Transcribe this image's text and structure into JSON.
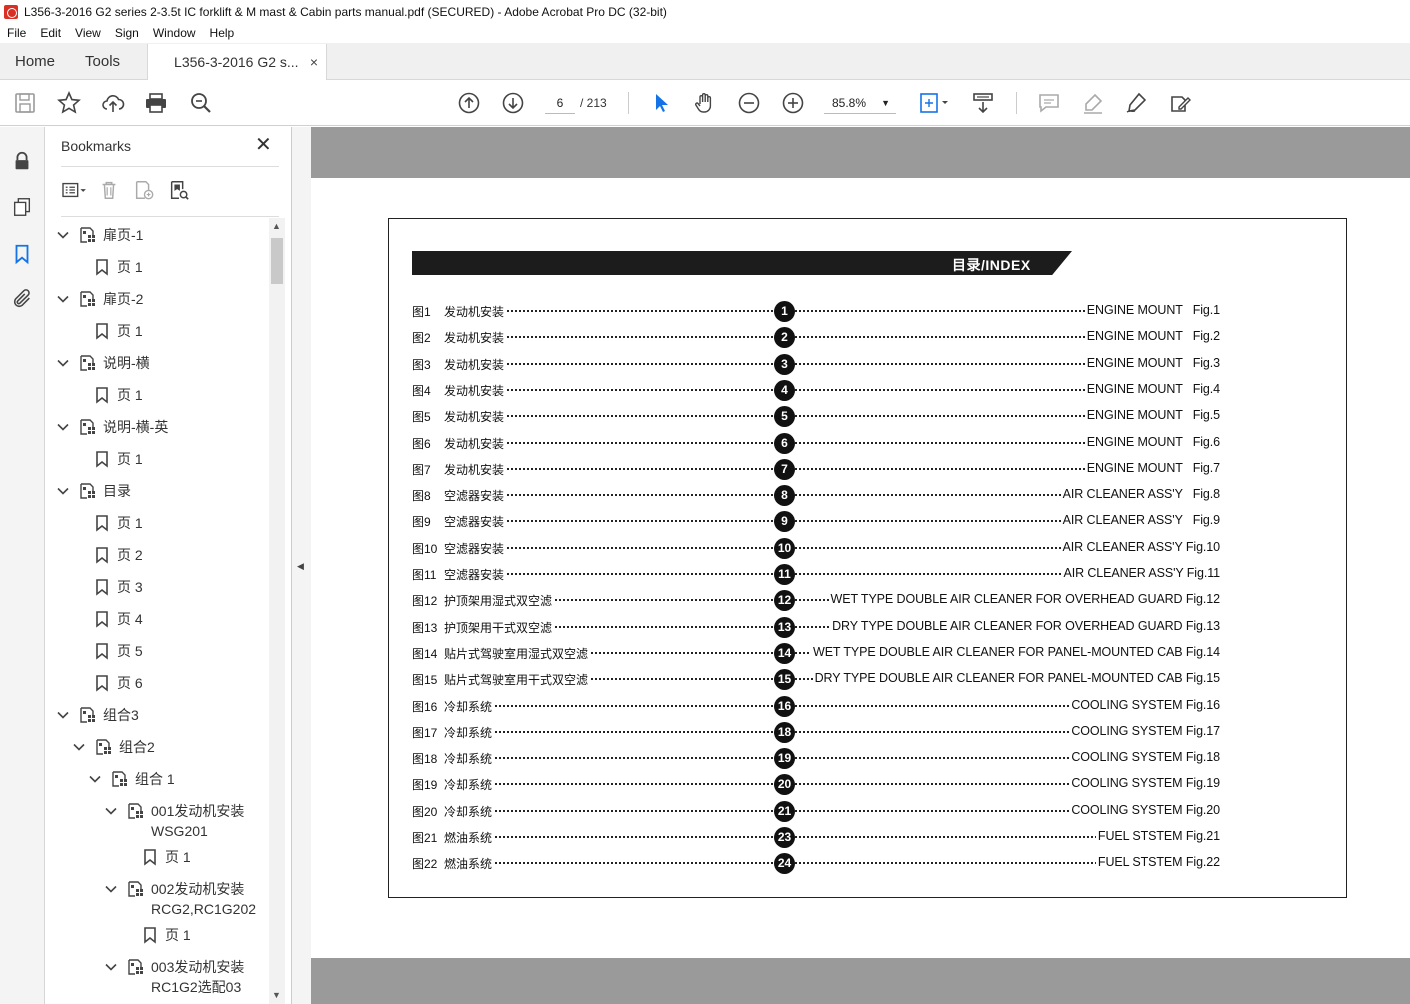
{
  "window": {
    "title": "L356-3-2016 G2 series 2-3.5t IC forklift & M mast & Cabin parts manual.pdf (SECURED) - Adobe Acrobat Pro DC (32-bit)"
  },
  "menu": [
    "File",
    "Edit",
    "View",
    "Sign",
    "Window",
    "Help"
  ],
  "tabs": {
    "home": "Home",
    "tools": "Tools",
    "document": "L356-3-2016 G2 s...",
    "close": "×"
  },
  "toolbar": {
    "page_current": "6",
    "page_total": "/ 213",
    "zoom": "85.8%",
    "zoom_caret": "▼"
  },
  "bookmarks": {
    "header": "Bookmarks",
    "close": "✕",
    "items": [
      {
        "label": "扉页-1",
        "type": "group",
        "level": 0
      },
      {
        "label": "页 1",
        "type": "page",
        "level": 1
      },
      {
        "label": "扉页-2",
        "type": "group",
        "level": 0
      },
      {
        "label": "页 1",
        "type": "page",
        "level": 1
      },
      {
        "label": "说明-横",
        "type": "group",
        "level": 0
      },
      {
        "label": "页 1",
        "type": "page",
        "level": 1
      },
      {
        "label": "说明-横-英",
        "type": "group",
        "level": 0
      },
      {
        "label": "页 1",
        "type": "page",
        "level": 1
      },
      {
        "label": "目录",
        "type": "group",
        "level": 0
      },
      {
        "label": "页 1",
        "type": "page",
        "level": 1
      },
      {
        "label": "页 2",
        "type": "page",
        "level": 1
      },
      {
        "label": "页 3",
        "type": "page",
        "level": 1
      },
      {
        "label": "页 4",
        "type": "page",
        "level": 1
      },
      {
        "label": "页 5",
        "type": "page",
        "level": 1
      },
      {
        "label": "页 6",
        "type": "page",
        "level": 1
      },
      {
        "label": "组合3",
        "type": "group",
        "level": 0
      },
      {
        "label": "组合2",
        "type": "group",
        "level": 1
      },
      {
        "label": "组合 1",
        "type": "group",
        "level": 2
      },
      {
        "label": "001发动机安装",
        "label2": "WSG201",
        "type": "group",
        "level": 3
      },
      {
        "label": "页 1",
        "type": "page",
        "level": 4
      },
      {
        "label": "002发动机安装",
        "label2": "RCG2,RC1G202",
        "type": "group",
        "level": 3
      },
      {
        "label": "页 1",
        "type": "page",
        "level": 4
      },
      {
        "label": "003发动机安装",
        "label2": "RC1G2选配03",
        "type": "group",
        "level": 3
      }
    ]
  },
  "document": {
    "index_title": "目录/INDEX",
    "rows": [
      {
        "fig": "图1",
        "cn": "发动机安装",
        "num": "1",
        "en": "ENGINE MOUNT   Fig.1"
      },
      {
        "fig": "图2",
        "cn": "发动机安装",
        "num": "2",
        "en": "ENGINE MOUNT   Fig.2"
      },
      {
        "fig": "图3",
        "cn": "发动机安装",
        "num": "3",
        "en": "ENGINE MOUNT   Fig.3"
      },
      {
        "fig": "图4",
        "cn": "发动机安装",
        "num": "4",
        "en": "ENGINE MOUNT   Fig.4"
      },
      {
        "fig": "图5",
        "cn": "发动机安装",
        "num": "5",
        "en": "ENGINE MOUNT   Fig.5"
      },
      {
        "fig": "图6",
        "cn": "发动机安装",
        "num": "6",
        "en": "ENGINE MOUNT   Fig.6"
      },
      {
        "fig": "图7",
        "cn": "发动机安装",
        "num": "7",
        "en": "ENGINE MOUNT   Fig.7"
      },
      {
        "fig": "图8",
        "cn": "空滤器安装",
        "num": "8",
        "en": "AIR CLEANER ASS'Y   Fig.8"
      },
      {
        "fig": "图9",
        "cn": "空滤器安装",
        "num": "9",
        "en": "AIR CLEANER ASS'Y   Fig.9"
      },
      {
        "fig": "图10",
        "cn": "空滤器安装",
        "num": "10",
        "en": "AIR CLEANER ASS'Y Fig.10"
      },
      {
        "fig": "图11",
        "cn": "空滤器安装",
        "num": "11",
        "en": "AIR CLEANER ASS'Y Fig.11"
      },
      {
        "fig": "图12",
        "cn": "护顶架用湿式双空滤",
        "num": "12",
        "en": "WET TYPE DOUBLE AIR CLEANER FOR OVERHEAD GUARD Fig.12"
      },
      {
        "fig": "图13",
        "cn": "护顶架用干式双空滤",
        "num": "13",
        "en": "DRY TYPE DOUBLE AIR CLEANER FOR OVERHEAD GUARD Fig.13"
      },
      {
        "fig": "图14",
        "cn": "贴片式驾驶室用湿式双空滤",
        "num": "14",
        "en": "WET TYPE DOUBLE AIR CLEANER FOR PANEL-MOUNTED CAB Fig.14"
      },
      {
        "fig": "图15",
        "cn": "贴片式驾驶室用干式双空滤",
        "num": "15",
        "en": "DRY TYPE DOUBLE AIR CLEANER FOR PANEL-MOUNTED CAB Fig.15"
      },
      {
        "fig": "图16",
        "cn": "冷却系统",
        "num": "16",
        "en": "COOLING SYSTEM Fig.16"
      },
      {
        "fig": "图17",
        "cn": "冷却系统",
        "num": "18",
        "en": "COOLING SYSTEM Fig.17"
      },
      {
        "fig": "图18",
        "cn": "冷却系统",
        "num": "19",
        "en": "COOLING SYSTEM Fig.18"
      },
      {
        "fig": "图19",
        "cn": "冷却系统",
        "num": "20",
        "en": "COOLING SYSTEM Fig.19"
      },
      {
        "fig": "图20",
        "cn": "冷却系统",
        "num": "21",
        "en": "COOLING SYSTEM Fig.20"
      },
      {
        "fig": "图21",
        "cn": "燃油系统",
        "num": "23",
        "en": "FUEL STSTEM Fig.21"
      },
      {
        "fig": "图22",
        "cn": "燃油系统",
        "num": "24",
        "en": "FUEL STSTEM Fig.22"
      }
    ]
  },
  "colors": {
    "accent": "#1473e6",
    "doc_background": "#9a9a9a",
    "index_bar": "#1c1c1c"
  }
}
